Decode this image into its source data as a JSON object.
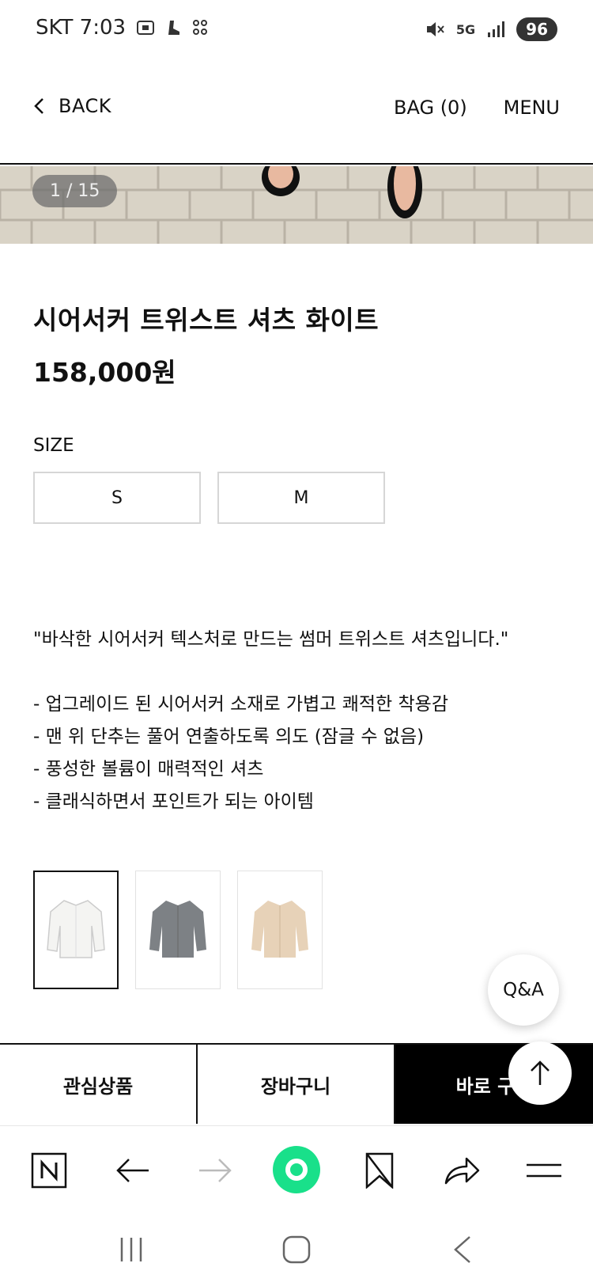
{
  "status_bar": {
    "carrier_time": "SKT 7:03",
    "network": "5G",
    "battery": "96",
    "icons": [
      "screenshot-icon",
      "shoe-icon",
      "dots-icon",
      "mute-icon",
      "signal-icon"
    ]
  },
  "header": {
    "back_label": "BACK",
    "bag_label": "BAG (0)",
    "menu_label": "MENU"
  },
  "gallery": {
    "counter": "1 / 15"
  },
  "product": {
    "title": "시어서커 트위스트 셔츠 화이트",
    "price": "158,000원",
    "size_label": "SIZE",
    "sizes": [
      "S",
      "M"
    ],
    "description": {
      "headline": "\"바삭한 시어서커 텍스처로 만드는 썸머 트위스트 셔츠입니다.\"",
      "bullets": [
        "- 업그레이드 된 시어서커 소재로 가볍고 쾌적한 착용감",
        "- 맨 위 단추는 풀어 연출하도록 의도 (잠글 수 없음)",
        "- 풍성한 볼륨이 매력적인 셔츠",
        "- 클래식하면서 포인트가 되는 아이템"
      ]
    },
    "color_options": [
      "white",
      "gray",
      "beige"
    ],
    "color_hex": {
      "white": "#f4f4f2",
      "gray": "#7d8185",
      "beige": "#e7d2b8"
    }
  },
  "floating": {
    "qa_label": "Q&A"
  },
  "actions": {
    "wishlist": "관심상품",
    "cart": "장바구니",
    "buy_now": "바로 구매"
  },
  "browser_toolbar": {
    "icons": [
      "naver-icon",
      "back-arrow-icon",
      "forward-arrow-icon",
      "home-circle-icon",
      "bookmark-icon",
      "share-icon",
      "menu-icon"
    ]
  },
  "nav_bar": {
    "icons": [
      "recents-icon",
      "home-icon",
      "back-icon"
    ]
  }
}
